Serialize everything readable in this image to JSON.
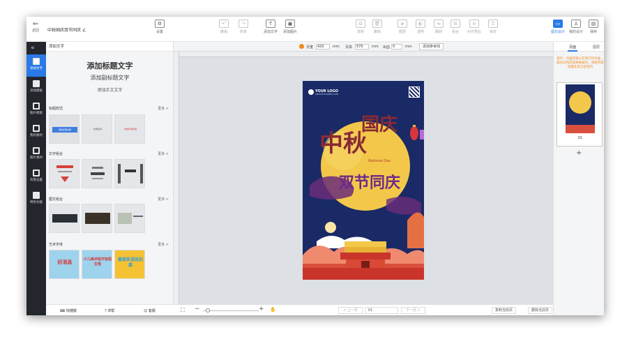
{
  "topbar": {
    "back_label": "返回",
    "doc_title": "中秋国庆双节同庆 ∠",
    "settings_label": "设置",
    "undo_label": "撤销",
    "redo_label": "恢复",
    "add_text_label": "添加文字",
    "add_image_label": "添加图片",
    "copy_label": "复制",
    "delete_label": "删除",
    "layer_label": "图层",
    "opacity_label": "透明",
    "flip_label": "翻转",
    "group_label": "组合",
    "align_label": "对齐居右",
    "lock_label": "锁定",
    "submit_label": "提交设计",
    "my_design_label": "我的设计",
    "save_label": "保存"
  },
  "leftbar": {
    "collapse_glyph": "«",
    "items": [
      {
        "label": "添加文字"
      },
      {
        "label": "添加模板"
      },
      {
        "label": "图片模版"
      },
      {
        "label": "我的素材"
      },
      {
        "label": "图片素材"
      },
      {
        "label": "背景设置"
      },
      {
        "label": "特色功能"
      }
    ]
  },
  "panel": {
    "head": "添加文字",
    "big_title": "添加标题文字",
    "sub_title": "添加副标题文字",
    "body_text": "添加正文文字",
    "sections": [
      {
        "label": "标题样式",
        "more": "更多 >"
      },
      {
        "label": "文字组合",
        "more": "更多 >"
      },
      {
        "label": "图文组合",
        "more": "更多 >"
      },
      {
        "label": "艺术字体",
        "more": "更多 >"
      }
    ],
    "title_styles": [
      "添加标题内容",
      "标题名称",
      "添加标题内容"
    ],
    "art_fonts": [
      "好消息",
      "少儿美术班开始招生啦",
      "暑期英语班招募"
    ],
    "footer": {
      "shortcut": "快捷键",
      "help": "求帮",
      "feedback": "客服"
    }
  },
  "canvas": {
    "page_label": "页宽",
    "page_width": "420",
    "unit1": "mm",
    "page_height_label": "页高",
    "page_height": "570",
    "unit2": "mm",
    "bleed_label": "出血",
    "bleed": "0",
    "unit3": "mm",
    "ref_line_label": "添加参考线",
    "zoom_minus": "−",
    "zoom_plus": "+",
    "prev_page": "< 上一页",
    "page_select": "01",
    "next_page": "下一页 >",
    "copy_page": "复制当前页",
    "delete_page": "删除当前页"
  },
  "poster": {
    "logo": "YOUR LOGO",
    "logo_sub": "CREATIVE BUSINESS CARD",
    "heading_1": "中秋",
    "heading_2": "国庆",
    "heading_3": "双节同庆",
    "en_text": "National Day"
  },
  "right": {
    "tab_page": "页面",
    "tab_layer": "图层",
    "tip": "提示：页面内容以实际打印为准，超出灰色区域将被裁切，请将内容放置在安全区域内",
    "page_number": "01",
    "add_page": "+"
  },
  "colors": {
    "accent": "#2a79e6",
    "poster_bg": "#1a2a66",
    "moon": "#f3c84a",
    "red": "#c9342b"
  }
}
